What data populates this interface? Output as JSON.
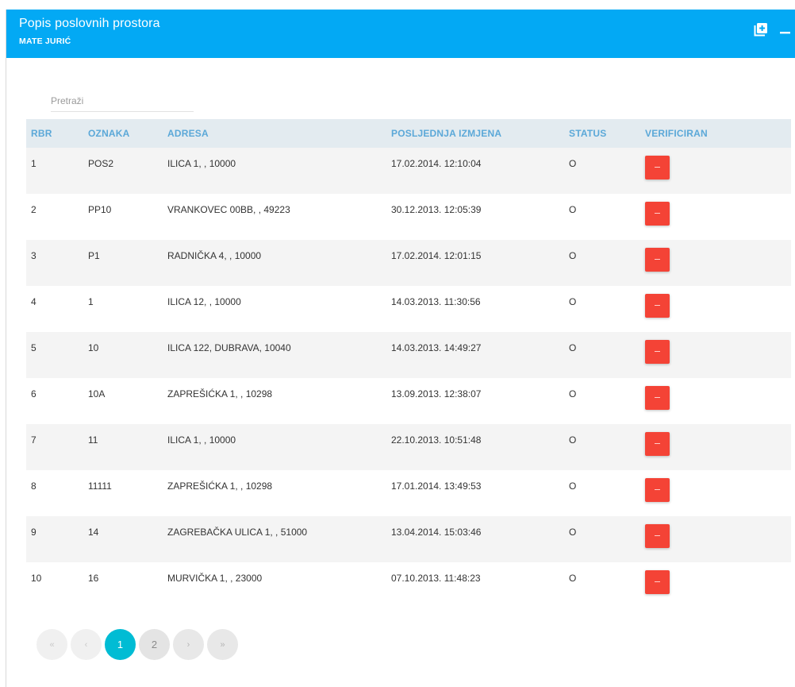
{
  "header": {
    "title": "Popis poslovnih prostora",
    "subtitle": "MATE JURIĆ",
    "add_icon": "add-box-icon",
    "minimize_icon": "minimize-icon",
    "color": "#03a9f4"
  },
  "search": {
    "placeholder": "Pretraži",
    "value": ""
  },
  "table": {
    "columns": [
      "RBR",
      "OZNAKA",
      "ADRESA",
      "POSLJEDNJA IZMJENA",
      "STATUS",
      "VERIFICIRAN"
    ],
    "rows": [
      {
        "rbr": "1",
        "oznaka": "POS2",
        "adresa": "ILICA 1, , 10000",
        "izmjena": "17.02.2014. 12:10:04",
        "status": "O"
      },
      {
        "rbr": "2",
        "oznaka": "PP10",
        "adresa": "VRANKOVEC 00BB, , 49223",
        "izmjena": "30.12.2013. 12:05:39",
        "status": "O"
      },
      {
        "rbr": "3",
        "oznaka": "P1",
        "adresa": "RADNIČKA 4, , 10000",
        "izmjena": "17.02.2014. 12:01:15",
        "status": "O"
      },
      {
        "rbr": "4",
        "oznaka": "1",
        "adresa": "ILICA 12, , 10000",
        "izmjena": "14.03.2013. 11:30:56",
        "status": "O"
      },
      {
        "rbr": "5",
        "oznaka": "10",
        "adresa": "ILICA 122, DUBRAVA, 10040",
        "izmjena": "14.03.2013. 14:49:27",
        "status": "O"
      },
      {
        "rbr": "6",
        "oznaka": "10A",
        "adresa": "ZAPREŠIĆKA 1, , 10298",
        "izmjena": "13.09.2013. 12:38:07",
        "status": "O"
      },
      {
        "rbr": "7",
        "oznaka": "11",
        "adresa": "ILICA 1, , 10000",
        "izmjena": "22.10.2013. 10:51:48",
        "status": "O"
      },
      {
        "rbr": "8",
        "oznaka": "11111",
        "adresa": "ZAPREŠIĆKA 1, , 10298",
        "izmjena": "17.01.2014. 13:49:53",
        "status": "O"
      },
      {
        "rbr": "9",
        "oznaka": "14",
        "adresa": "ZAGREBAČKA ULICA 1, , 51000",
        "izmjena": "13.04.2014. 15:03:46",
        "status": "O"
      },
      {
        "rbr": "10",
        "oznaka": "16",
        "adresa": "MURVIČKA 1, , 23000",
        "izmjena": "07.10.2013. 11:48:23",
        "status": "O"
      }
    ],
    "verified_button": {
      "icon": "minus-icon",
      "color": "#f44336"
    }
  },
  "pagination": {
    "first": "«",
    "prev": "‹",
    "pages": [
      "1",
      "2"
    ],
    "current": "1",
    "next": "›",
    "last": "»",
    "active_color": "#00bcd4"
  }
}
